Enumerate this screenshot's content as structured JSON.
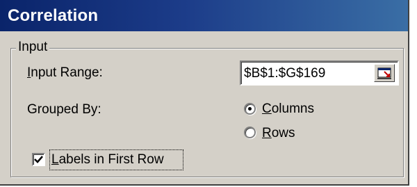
{
  "window": {
    "title": "Correlation"
  },
  "input_group": {
    "legend": "Input",
    "input_range_label": "Input Range:",
    "input_range_value": "$B$1:$G$169",
    "grouped_by_label": "Grouped By:",
    "grouped_by_options": [
      {
        "label": "Columns",
        "selected": true
      },
      {
        "label": "Rows",
        "selected": false
      }
    ],
    "labels_in_first_row": {
      "label": "Labels in First Row",
      "checked": true
    }
  },
  "icons": {
    "range_button": "collapse-dialog-icon",
    "checkmark": "checkmark-icon"
  },
  "colors": {
    "title_bar_start": "#0a246a",
    "title_bar_end": "#3a6ea5",
    "dialog_face": "#d4d0c8"
  }
}
